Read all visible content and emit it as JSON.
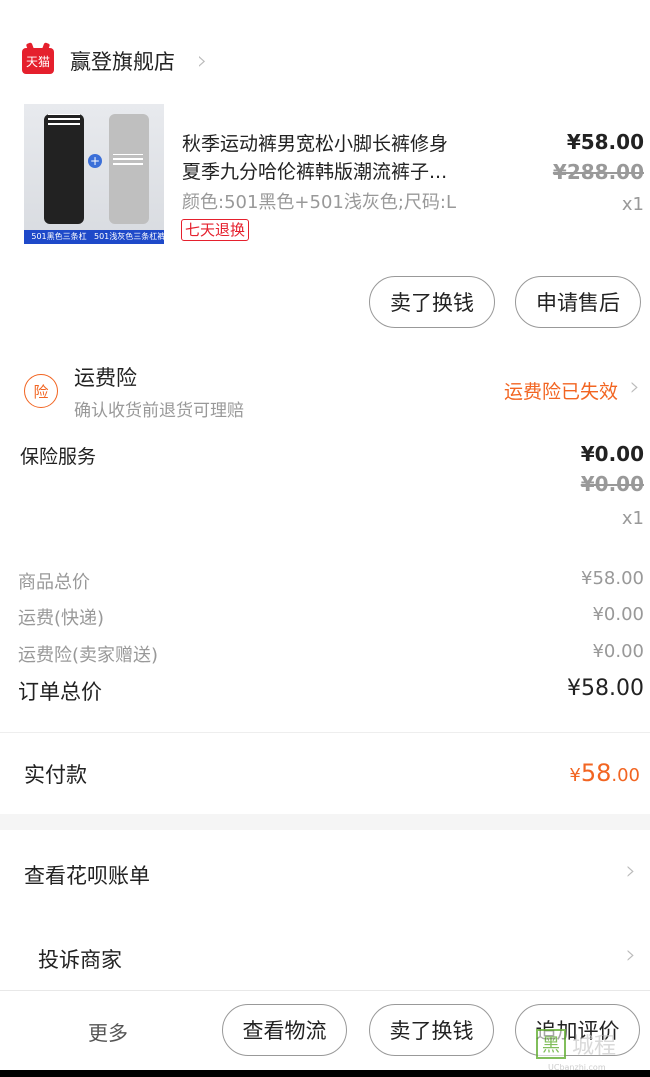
{
  "store": {
    "badge": "天猫",
    "name": "赢登旗舰店",
    "chevron_icon": "chevron-right-icon"
  },
  "product": {
    "title_line1": "秋季运动裤男宽松小脚长裤修身",
    "title_line2": "夏季九分哈伦裤韩版潮流裤子...",
    "spec": "颜色:501黑色+501浅灰色;尺码:L",
    "return_tag": "七天退换",
    "price": "¥58.00",
    "original_price": "¥288.00",
    "quantity": "x1",
    "image_caption_left": "501黑色三条杠",
    "image_caption_right": "501浅灰色三条杠裤",
    "image_plus": "+"
  },
  "item_actions": {
    "sell_label": "卖了换钱",
    "after_sale_label": "申请售后"
  },
  "freight_insurance": {
    "icon_char": "险",
    "title": "运费险",
    "subtitle": "确认收货前退货可理赔",
    "status": "运费险已失效"
  },
  "insurance_service": {
    "title": "保险服务",
    "price": "¥0.00",
    "original_price": "¥0.00",
    "quantity": "x1"
  },
  "summary": {
    "rows": [
      {
        "label": "商品总价",
        "value": "¥58.00"
      },
      {
        "label": "运费(快递)",
        "value": "¥0.00"
      },
      {
        "label": "运费险(卖家赠送)",
        "value": "¥0.00"
      }
    ],
    "total_label": "订单总价",
    "total_value": "¥58.00"
  },
  "payment": {
    "label": "实付款",
    "currency": "¥",
    "integer": "58",
    "decimal": ".00"
  },
  "links": {
    "huabei": "查看花呗账单",
    "complain": "投诉商家"
  },
  "bottom_bar": {
    "more": "更多",
    "logistics": "查看物流",
    "sell": "卖了换钱",
    "review": "追加评价"
  },
  "watermark": {
    "box_char": "黑",
    "text": "城程",
    "url": "UCbanzhi.com"
  },
  "colors": {
    "accent": "#f26522",
    "tmall_red": "#e5202d"
  }
}
